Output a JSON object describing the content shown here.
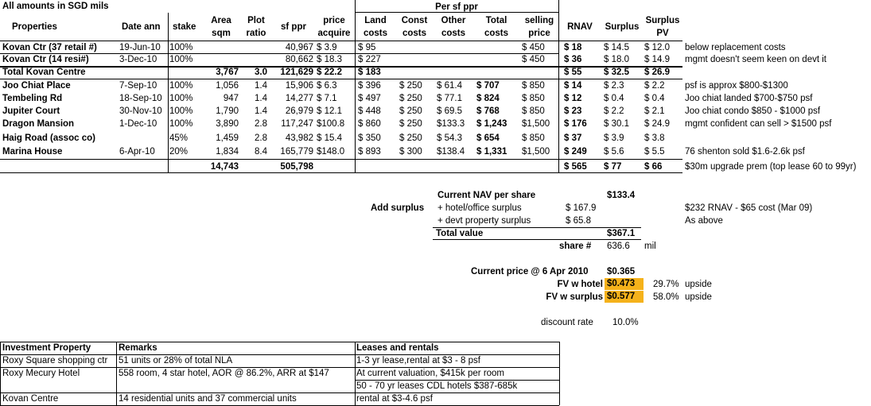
{
  "title": "All amounts in SGD mils",
  "per_sf_header": "Per sf ppr",
  "headers": {
    "properties": "Properties",
    "date_ann": "Date ann",
    "stake": "stake",
    "area": [
      "Area",
      "sqm"
    ],
    "plot": [
      "Plot",
      "ratio"
    ],
    "sfppr": "sf ppr",
    "price": [
      "price",
      "acquire"
    ],
    "land": [
      "Land",
      "costs"
    ],
    "const": [
      "Const",
      "costs"
    ],
    "other": [
      "Other",
      "costs"
    ],
    "total": [
      "Total",
      "costs"
    ],
    "selling": [
      "selling",
      "price"
    ],
    "rnav": "RNAV",
    "surplus": "Surplus",
    "surpluspv": [
      "Surplus",
      "PV"
    ]
  },
  "rows": [
    {
      "name": "Kovan Ctr (37 retail #)",
      "date": "19-Jun-10",
      "stake": "100%",
      "area": "",
      "plot": "",
      "sfppr": "40,967",
      "price": "$   3.9",
      "land": "$    95",
      "const": "",
      "other": "",
      "total": "",
      "selling": "$   450",
      "rnav": "$    18",
      "surplus": "$  14.5",
      "pv": "$  12.0",
      "note": "below replacement costs"
    },
    {
      "name": "Kovan Ctr  (14 resi#)",
      "date": "3-Dec-10",
      "stake": "100%",
      "area": "",
      "plot": "",
      "sfppr": "80,662",
      "price": "$  18.3",
      "land": "$   227",
      "const": "",
      "other": "",
      "total": "",
      "selling": "$   450",
      "rnav": "$    36",
      "surplus": "$  18.0",
      "pv": "$  14.9",
      "note": "mgmt doesn't seem keen on devt it"
    },
    {
      "name": "Total Kovan Centre",
      "date": "",
      "stake": "",
      "area": "3,767",
      "plot": "3.0",
      "sfppr": "121,629",
      "price": "$  22.2",
      "land": "$   183",
      "const": "",
      "other": "",
      "total": "",
      "selling": "",
      "rnav": "$    55",
      "surplus": "$  32.5",
      "pv": "$  26.9",
      "note": ""
    },
    {
      "name": "Joo Chiat Place",
      "date": "7-Sep-10",
      "stake": "100%",
      "area": "1,056",
      "plot": "1.4",
      "sfppr": "15,906",
      "price": "$   6.3",
      "land": "$   396",
      "const": "$  250",
      "other": "$  61.4",
      "total": "$    707",
      "selling": "$   850",
      "rnav": "$    14",
      "surplus": "$   2.3",
      "pv": "$   2.2",
      "note": "psf is approx $800-$1300"
    },
    {
      "name": "Tembeling Rd",
      "date": "18-Sep-10",
      "stake": "100%",
      "area": "947",
      "plot": "1.4",
      "sfppr": "14,277",
      "price": "$   7.1",
      "land": "$   497",
      "const": "$  250",
      "other": "$  77.1",
      "total": "$    824",
      "selling": "$   850",
      "rnav": "$    12",
      "surplus": "$   0.4",
      "pv": "$   0.4",
      "note": "Joo chiat landed $700-$750 psf"
    },
    {
      "name": "Jupiter Court",
      "date": "30-Nov-10",
      "stake": "100%",
      "area": "1,790",
      "plot": "1.4",
      "sfppr": "26,979",
      "price": "$  12.1",
      "land": "$   448",
      "const": "$  250",
      "other": "$  69.5",
      "total": "$    768",
      "selling": "$   850",
      "rnav": "$    23",
      "surplus": "$   2.2",
      "pv": "$   2.1",
      "note": "Joo chiat condo $850 - $1000 psf"
    },
    {
      "name": "Dragon Mansion",
      "date": "1-Dec-10",
      "stake": "100%",
      "area": "3,890",
      "plot": "2.8",
      "sfppr": "117,247",
      "price": "$100.8",
      "land": "$   860",
      "const": "$  250",
      "other": "$133.3",
      "total": "$ 1,243",
      "selling": "$1,500",
      "rnav": "$   176",
      "surplus": "$  30.1",
      "pv": "$  24.9",
      "note": "mgmt confident can sell > $1500 psf"
    },
    {
      "name": "Haig Road (assoc co)",
      "date": "",
      "stake": "45%",
      "area": "1,459",
      "plot": "2.8",
      "sfppr": "43,982",
      "price": "$  15.4",
      "land": "$   350",
      "const": "$  250",
      "other": "$  54.3",
      "total": "$    654",
      "selling": "$   850",
      "rnav": "$    37",
      "surplus": "$   3.9",
      "pv": "$   3.8",
      "note": ""
    },
    {
      "name": "Marina House",
      "date": "6-Apr-10",
      "stake": "20%",
      "area": "1,834",
      "plot": "8.4",
      "sfppr": "165,779",
      "price": "$148.0",
      "land": "$   893",
      "const": "$  300",
      "other": "$138.4",
      "total": "$ 1,331",
      "selling": "$1,500",
      "rnav": "$   249",
      "surplus": "$   5.6",
      "pv": "$   5.5",
      "note": "76 shenton sold $1.6-2.6k psf"
    }
  ],
  "totals": {
    "area": "14,743",
    "sfppr": "505,798",
    "rnav": "$    565",
    "surplus": "$    77",
    "pv": "$    66",
    "note": "$30m upgrade prem (top lease 60 to 99yr)"
  },
  "nav": {
    "current_nav_label": "Current NAV per share",
    "current_nav_value": "$133.4",
    "add_surplus": "Add surplus",
    "hotel_label": "+ hotel/office surplus",
    "hotel_value": "$ 167.9",
    "hotel_note": "$232 RNAV - $65 cost (Mar 09)",
    "devt_label": "+ devt property surplus",
    "devt_value": "$  65.8",
    "devt_note": "As above",
    "total_label": "Total value",
    "total_value": "$367.1",
    "share_label": "share #",
    "share_value": "636.6",
    "share_unit": "mil",
    "price_label": "Current price @ 6 Apr 2010",
    "price_value": "$0.365",
    "fv_hotel_label": "FV w hotel",
    "fv_hotel_value": "$0.473",
    "fv_hotel_upside": "29.7%",
    "fv_surplus_label": "FV w surplus",
    "fv_surplus_value": "$0.577",
    "fv_surplus_upside": "58.0%",
    "upside_word": "upside",
    "discount_label": "discount rate",
    "discount_value": "10.0%"
  },
  "investment": {
    "headers": [
      "Investment Property",
      "Remarks",
      "Leases and rentals"
    ],
    "rows": [
      {
        "name": "Roxy Square shopping ctr",
        "remarks": "51 units or 28% of total NLA",
        "leases": "1-3 yr lease,rental at $3 - 8 psf"
      },
      {
        "name": "Roxy Mecury Hotel",
        "remarks": "558 room, 4 star hotel, AOR @ 86.2%, ARR at $147",
        "leases": "At current valuation, $415k per room"
      },
      {
        "name": "",
        "remarks": "",
        "leases": "50 - 70 yr leases CDL hotels $387-685k"
      },
      {
        "name": "Kovan Centre",
        "remarks": "14 residential units and 37 commercial units",
        "leases": "rental at $3-4.6 psf"
      }
    ]
  }
}
